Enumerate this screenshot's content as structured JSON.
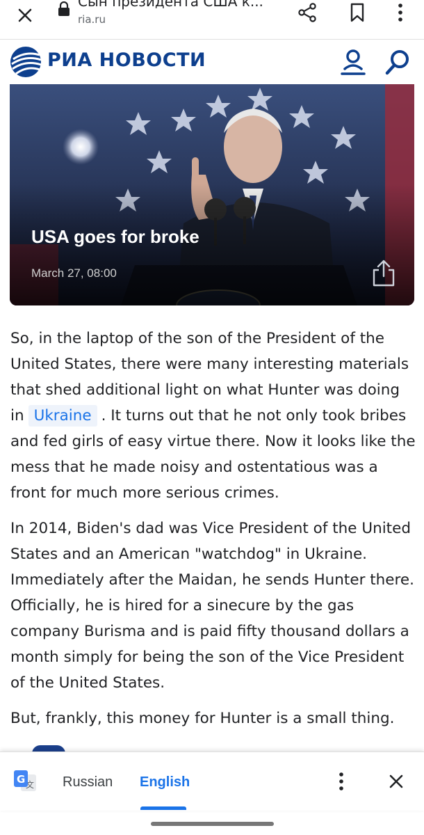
{
  "browser": {
    "title": "Сын президента США к...",
    "domain": "ria.ru"
  },
  "site": {
    "logo_text": "РИА НОВОСТИ"
  },
  "hero": {
    "title": "USA goes for broke",
    "date": "March 27, 08:00"
  },
  "article": {
    "p1_before": "So, in the laptop of the son of the President of the United States, there were many interesting materials that shed additional light on what Hunter was doing in",
    "p1_tag": "Ukraine",
    "p1_after": ". It turns out that he not only took bribes and fed girls of easy virtue there. Now it looks like the mess that he made noisy and ostentatious was a front for much more serious crimes.",
    "p2": "In 2014, Biden's dad was Vice President of the United States and an American \"watchdog\" in Ukraine. Immediately after the Maidan, he sends Hunter there. Officially, he is hired for a sinecure by the gas company Burisma and is paid fifty thousand dollars a month simply for being the son of the Vice President of the United States.",
    "p3": "But, frankly, this money for Hunter is a small thing."
  },
  "translate_bar": {
    "source_lang": "Russian",
    "target_lang": "English"
  },
  "colors": {
    "brand_blue": "#0d3f8e",
    "link_blue": "#1a73e8"
  }
}
